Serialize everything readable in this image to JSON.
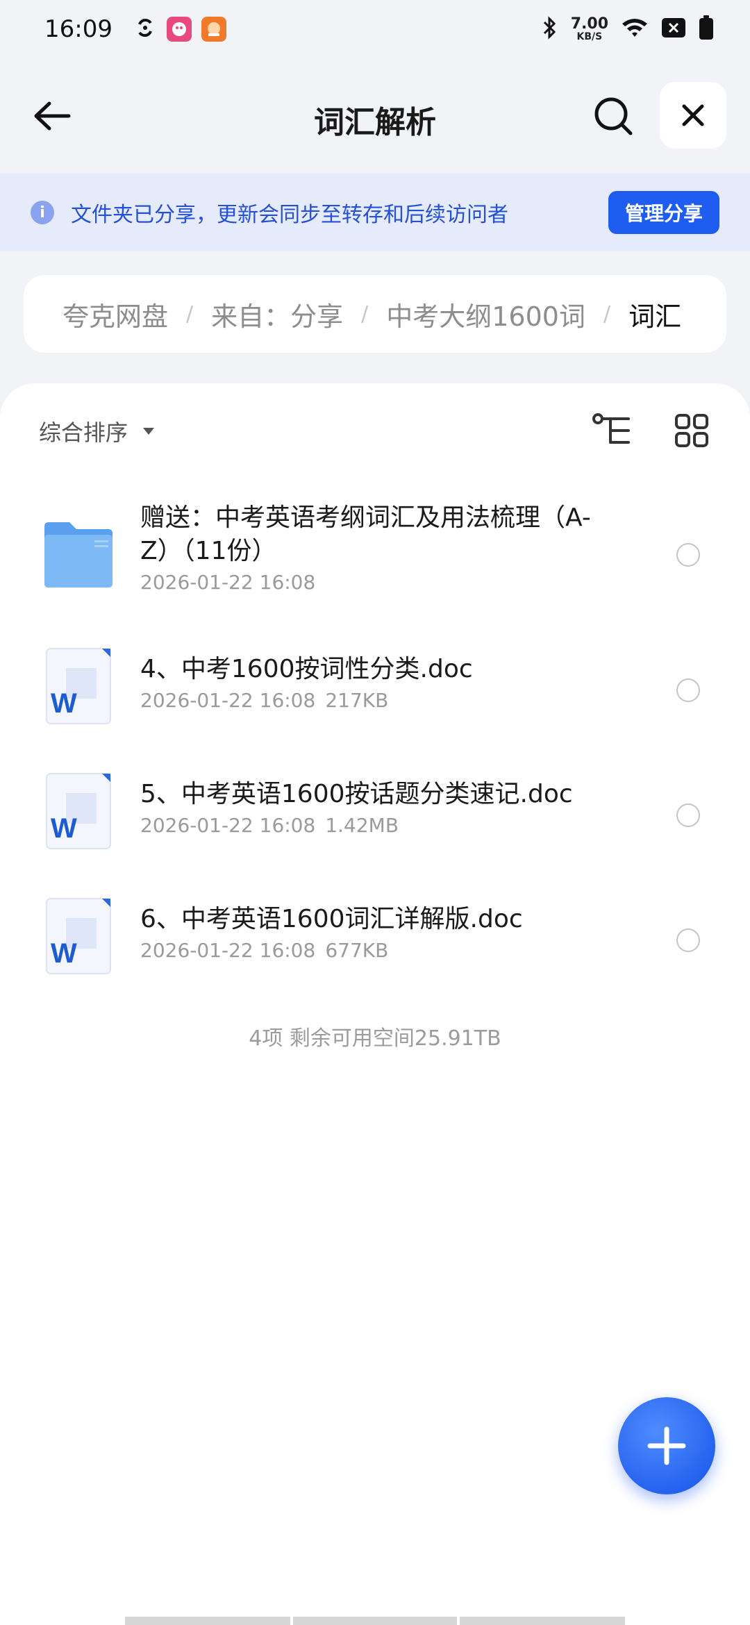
{
  "status_bar": {
    "time": "16:09",
    "net_speed_value": "7.00",
    "net_speed_unit": "KB/S",
    "icons": [
      "sync-icon",
      "app-badge-pink",
      "app-badge-orange",
      "bluetooth-icon",
      "wifi-icon",
      "close-box-icon",
      "battery-icon"
    ]
  },
  "header": {
    "title": "词汇解析"
  },
  "banner": {
    "text": "文件夹已分享，更新会同步至转存和后续访问者",
    "button_label": "管理分享",
    "info_glyph": "i"
  },
  "breadcrumb": {
    "items": [
      "夸克网盘",
      "来自：分享",
      "中考大纲1600词",
      "词汇"
    ],
    "separator": "/"
  },
  "toolbar": {
    "sort_label": "综合排序"
  },
  "files": [
    {
      "type": "folder",
      "name_line1": "赠送：中考英语考纲词汇及用法梳理（A-",
      "name_line2": "Z）（11份）",
      "date": "2026-01-22 16:08",
      "size": ""
    },
    {
      "type": "doc",
      "name_line1": "4、中考1600按词性分类.doc",
      "date": "2026-01-22 16:08",
      "size": "217KB"
    },
    {
      "type": "doc",
      "name_line1": "5、中考英语1600按话题分类速记.doc",
      "date": "2026-01-22 16:08",
      "size": "1.42MB"
    },
    {
      "type": "doc",
      "name_line1": "6、中考英语1600词汇详解版.doc",
      "date": "2026-01-22 16:08",
      "size": "677KB"
    }
  ],
  "summary": {
    "text": "4项 剩余可用空间25.91TB"
  },
  "colors": {
    "accent": "#1f5cf0",
    "banner_bg": "#e6ebfb",
    "folder": "#64a8f2",
    "word_blue": "#1d5bd0"
  }
}
